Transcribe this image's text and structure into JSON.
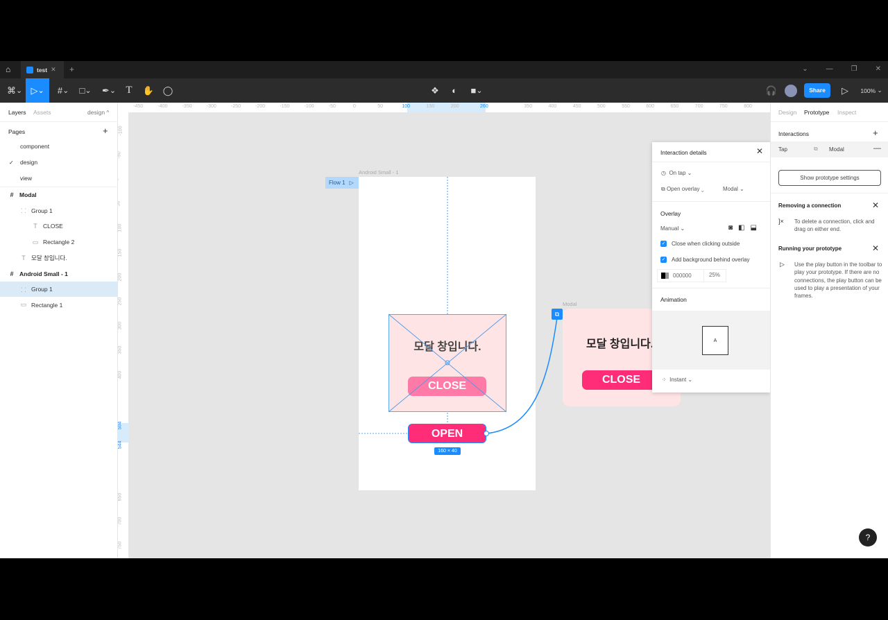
{
  "titlebar": {
    "tab": "test",
    "add": "+",
    "controls": [
      "⌄",
      "—",
      "❐",
      "✕"
    ]
  },
  "toolbar": {
    "share": "Share",
    "zoom": "100%"
  },
  "left": {
    "tabs": [
      "Layers",
      "Assets"
    ],
    "page_select": "design ^",
    "pages_title": "Pages",
    "pages": [
      {
        "name": "component",
        "active": false
      },
      {
        "name": "design",
        "active": true
      },
      {
        "name": "view",
        "active": false
      }
    ],
    "layers": [
      {
        "name": "Modal",
        "icon": "frame",
        "depth": 0
      },
      {
        "name": "Group 1",
        "icon": "group",
        "depth": 1
      },
      {
        "name": "CLOSE",
        "icon": "text",
        "depth": 2
      },
      {
        "name": "Rectangle 2",
        "icon": "rect",
        "depth": 2
      },
      {
        "name": "모달 창입니다.",
        "icon": "text",
        "depth": 1
      },
      {
        "name": "Android Small - 1",
        "icon": "frame",
        "depth": 0
      },
      {
        "name": "Group 1",
        "icon": "group",
        "depth": 1,
        "selected": true
      },
      {
        "name": "Rectangle 1",
        "icon": "rect",
        "depth": 1
      }
    ]
  },
  "ruler": {
    "h": [
      -450,
      -400,
      -350,
      -300,
      -250,
      -200,
      -150,
      -100,
      -50,
      0,
      50,
      100,
      150,
      200,
      260,
      350,
      400,
      450,
      500,
      550,
      600,
      650,
      700,
      750,
      800
    ],
    "h_highlight": [
      100,
      260
    ],
    "v": [
      -100,
      -50,
      0,
      50,
      100,
      150,
      200,
      250,
      300,
      350,
      400,
      504,
      544,
      650,
      700,
      750
    ],
    "v_highlight": [
      504,
      544
    ]
  },
  "canvas": {
    "frame_label": "Android Small - 1",
    "flow": "Flow 1",
    "modal_text": "모달 창입니다.",
    "close": "CLOSE",
    "open": "OPEN",
    "size": "160 × 40",
    "modal_label": "Modal",
    "accent": "#ff2d78",
    "modal_bg": "#ffe4e6",
    "selection": "#1a8cff"
  },
  "interaction": {
    "title": "Interaction details",
    "trigger": "On tap",
    "action": "Open overlay",
    "target": "Modal",
    "overlay_title": "Overlay",
    "position": "Manual",
    "close_outside": "Close when clicking outside",
    "add_bg": "Add background behind overlay",
    "bg_color": "000000",
    "bg_opacity": "25%",
    "animation_title": "Animation",
    "preview": "A",
    "anim": "Instant"
  },
  "right": {
    "tabs": [
      "Design",
      "Prototype",
      "Inspect"
    ],
    "interactions": "Interactions",
    "row": {
      "trigger": "Tap",
      "target": "Modal"
    },
    "settings_btn": "Show prototype settings",
    "remove_title": "Removing a connection",
    "remove_text": "To delete a connection, click and drag on either end.",
    "run_title": "Running your prototype",
    "run_text": "Use the play button in the toolbar to play your prototype. If there are no connections, the play button can be used to play a presentation of your frames.",
    "help": "?"
  }
}
